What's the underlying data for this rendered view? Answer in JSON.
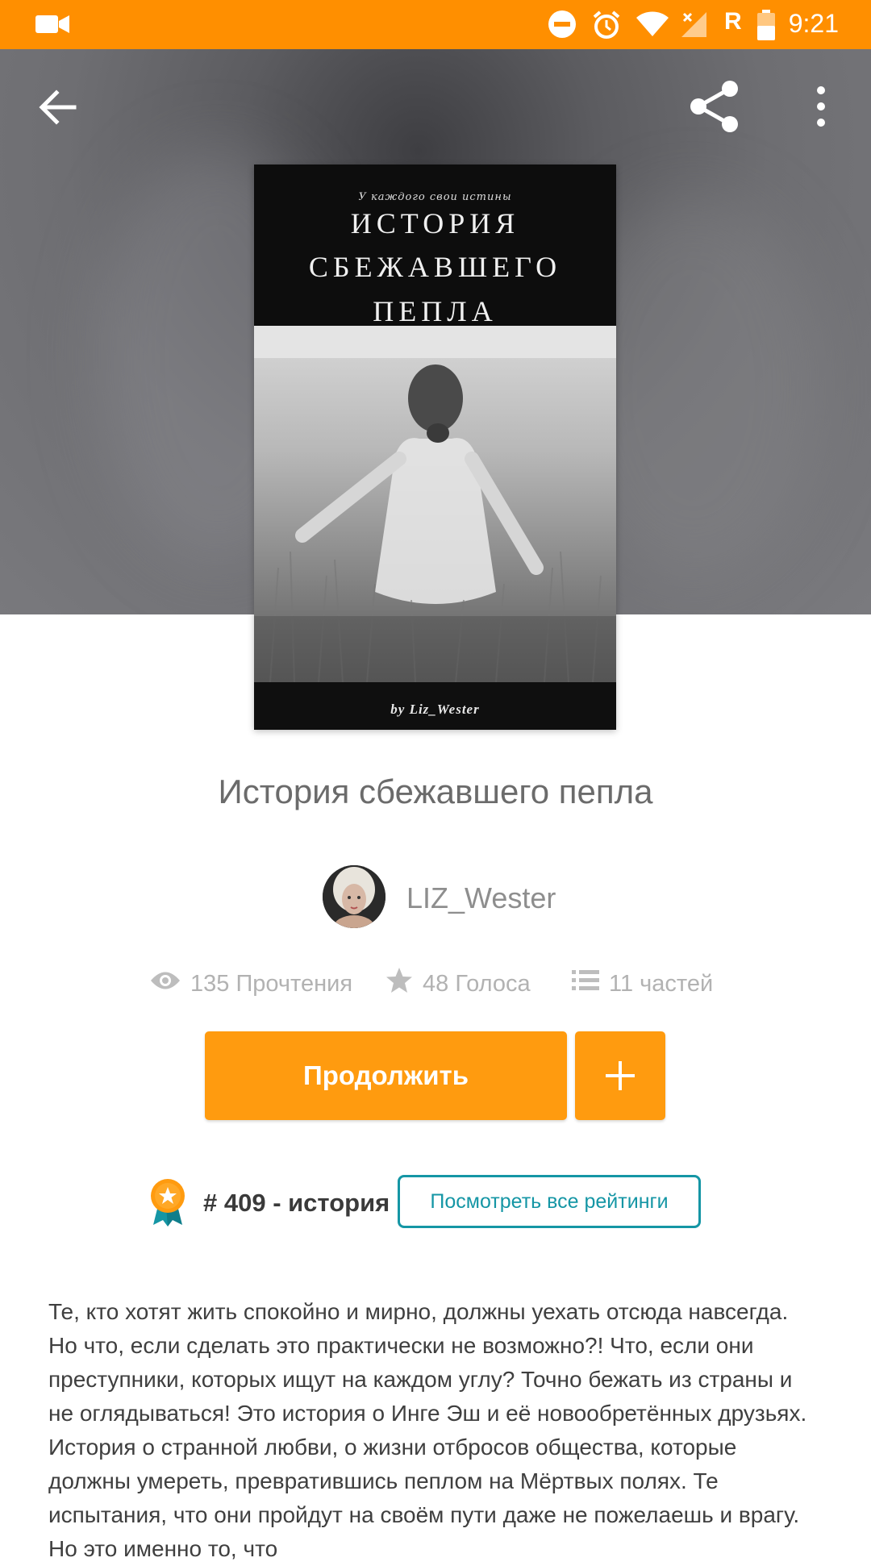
{
  "status_bar": {
    "time": "9:21",
    "network_label": "R",
    "icons": [
      "video-camera-icon",
      "do-not-disturb-icon",
      "alarm-icon",
      "wifi-icon",
      "signal-icon",
      "battery-icon"
    ]
  },
  "toolbar": {
    "icons": [
      "back-arrow-icon",
      "share-icon",
      "more-vertical-icon"
    ]
  },
  "cover": {
    "tagline": "У каждого свои истины",
    "title_lines": [
      "ИСТОРИЯ",
      "СБЕЖАВШЕГО",
      "ПЕПЛА"
    ],
    "byline": "by Liz_Wester"
  },
  "book": {
    "title": "История сбежавшего пепла",
    "author": "LIZ_Wester"
  },
  "stats": {
    "reads": "135 Прочтения",
    "votes": "48 Голоса",
    "parts": "11 частей"
  },
  "actions": {
    "continue_label": "Продолжить",
    "add_icon": "plus-icon"
  },
  "ranking": {
    "rank_text": "# 409 - история",
    "view_all_label": "Посмотреть все рейтинги"
  },
  "description": "Те, кто хотят жить спокойно и мирно, должны уехать отсюда навсегда. Но что, если сделать это практически не возможно?! Что, если они преступники, которых ищут на каждом углу? Точно бежать из страны и не оглядываться! Это история о Инге Эш и её новообретённых друзьях. История о странной любви, о жизни отбросов общества, которые должны умереть, превратившись пеплом на Мёртвых полях. Те испытания, что они пройдут на своём пути даже не пожелаешь и врагу. Но это именно то, что",
  "colors": {
    "accent": "#ff9b0f",
    "status_bar": "#ff8f00",
    "link": "#1596a5"
  }
}
